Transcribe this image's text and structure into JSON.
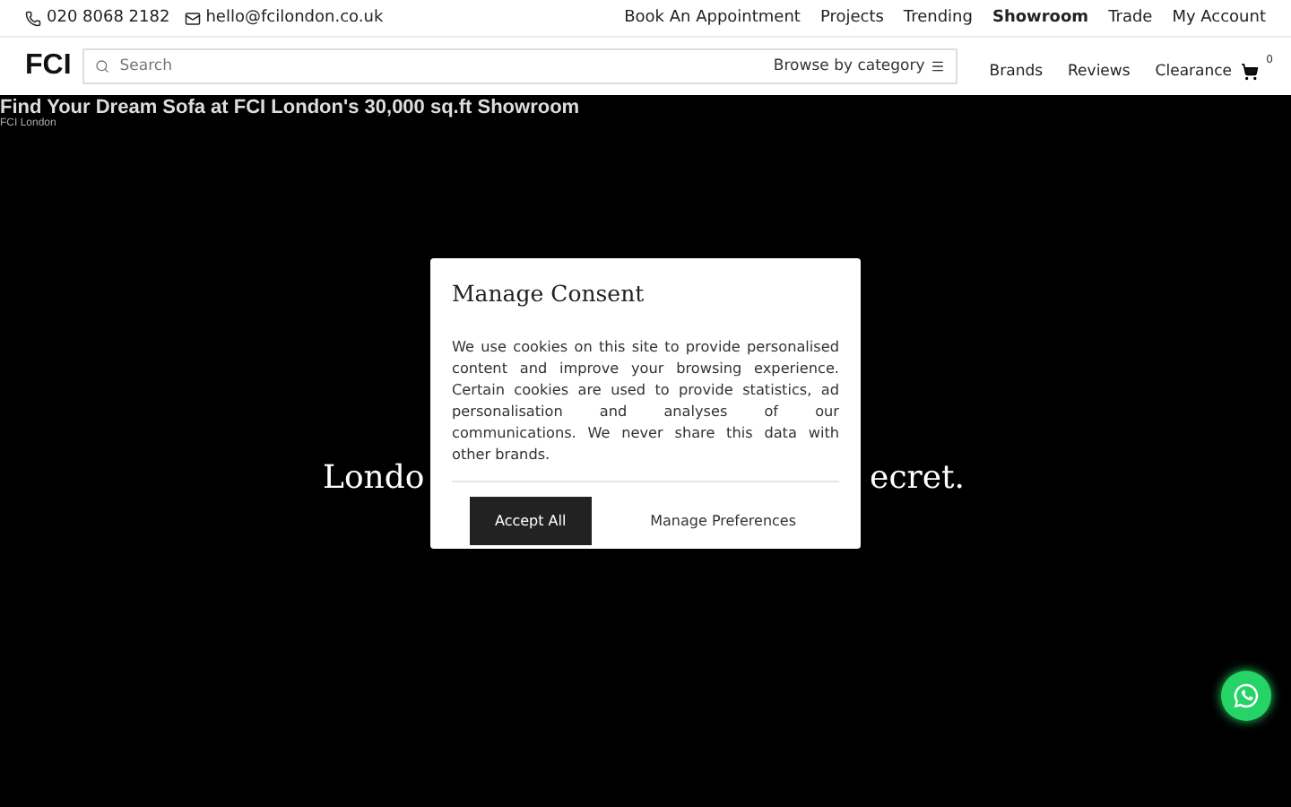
{
  "contact": {
    "phone": "020 8068 2182",
    "email": "hello@fcilondon.co.uk"
  },
  "top_nav": [
    {
      "label": "Book An Appointment",
      "selected": false
    },
    {
      "label": "Projects",
      "selected": false
    },
    {
      "label": "Trending",
      "selected": false
    },
    {
      "label": "Showroom",
      "selected": true
    },
    {
      "label": "Trade",
      "selected": false
    },
    {
      "label": "My Account",
      "selected": false
    }
  ],
  "logo": "FCI",
  "search": {
    "placeholder": "Search",
    "browse": "Browse by category"
  },
  "main_nav": [
    "Brands",
    "Reviews",
    "Clearance"
  ],
  "cart": {
    "count": "0"
  },
  "video": {
    "title": "Find Your Dream Sofa at FCI London's 30,000 sq.ft Showroom",
    "channel": "FCI London"
  },
  "hero": {
    "visible_start": "Londo",
    "visible_end": "ecret."
  },
  "consent": {
    "title": "Manage Consent",
    "body": "We use cookies on this site to provide personalised content and improve your browsing experience. Certain cookies are used to provide statistics, ad personalisation and analyses of our communications. We never share this data with other brands.",
    "buttons": [
      {
        "label": "Accept All",
        "kind": "primary"
      },
      {
        "label": "Manage Preferences",
        "kind": "plain"
      }
    ]
  }
}
